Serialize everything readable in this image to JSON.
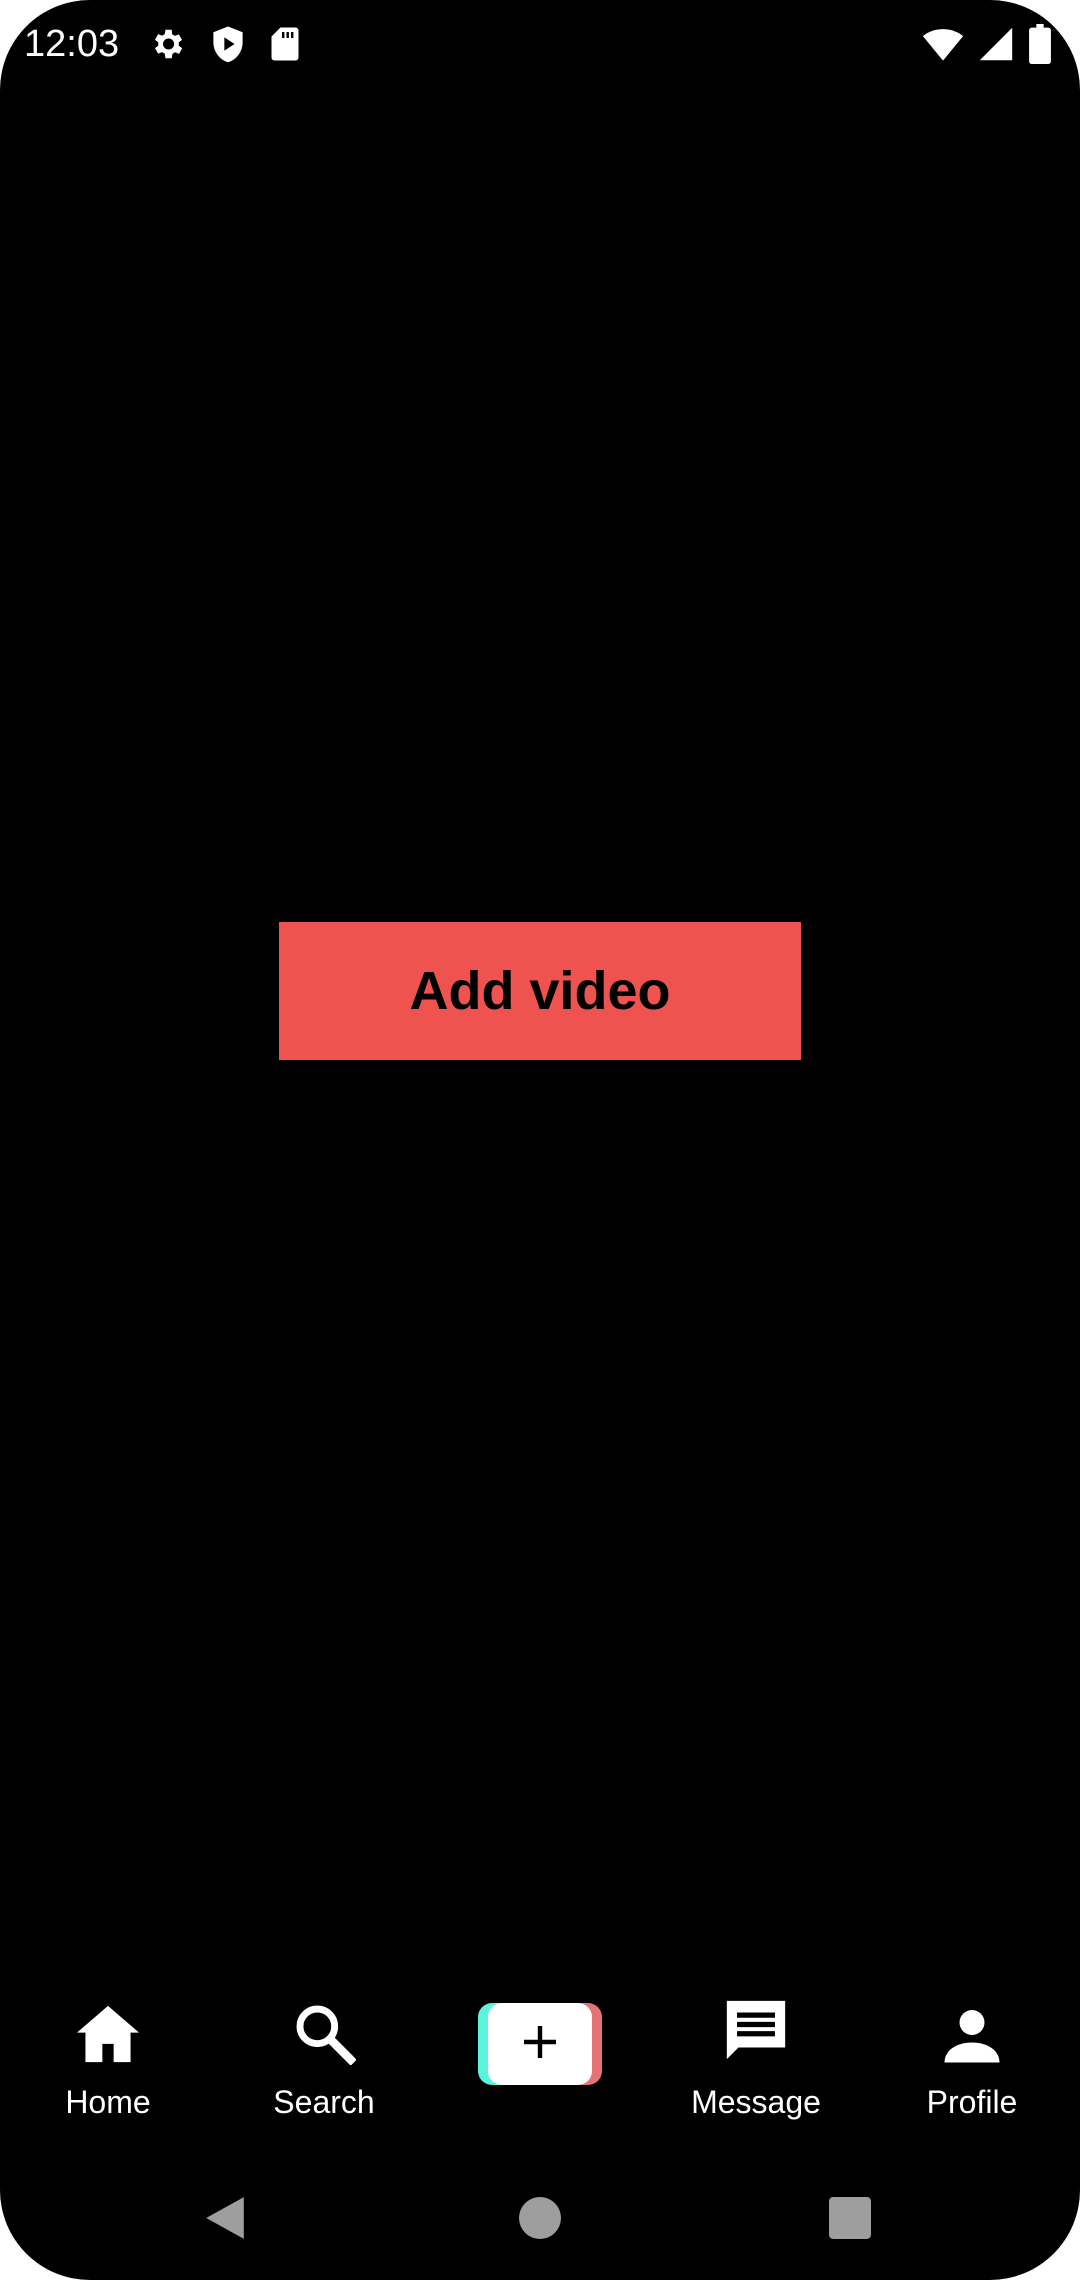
{
  "status_bar": {
    "time": "12:03",
    "left_icons": [
      "gear-icon",
      "shield-play-icon",
      "sd-card-icon"
    ],
    "right_icons": [
      "wifi-icon",
      "cell-signal-icon",
      "battery-icon"
    ]
  },
  "main": {
    "add_video_label": "Add video"
  },
  "bottom_nav": {
    "items": [
      {
        "label": "Home",
        "icon": "home-icon"
      },
      {
        "label": "Search",
        "icon": "search-icon"
      },
      {
        "label": "",
        "icon": "plus-icon"
      },
      {
        "label": "Message",
        "icon": "message-icon"
      },
      {
        "label": "Profile",
        "icon": "person-icon"
      }
    ]
  },
  "system_nav": {
    "buttons": [
      "back-icon",
      "home-circle-icon",
      "recents-icon"
    ]
  },
  "colors": {
    "background": "#000000",
    "accent_red": "#EF5350",
    "create_cyan": "#5BF3DC",
    "create_red": "#E57373",
    "text_light": "#FFFFFF",
    "system_nav_gray": "#9E9E9E"
  }
}
